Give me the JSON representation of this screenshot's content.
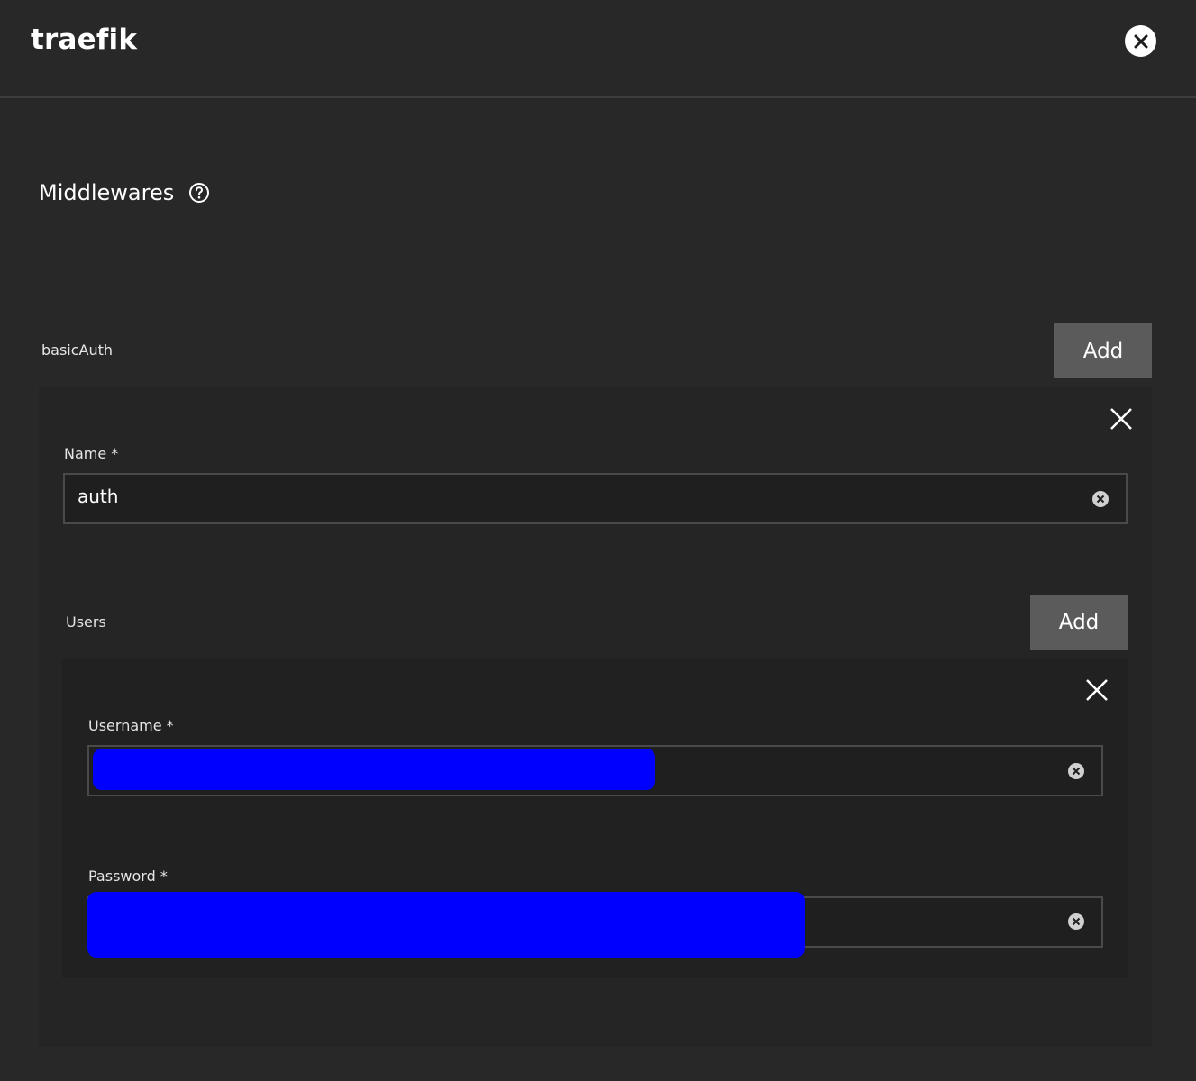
{
  "app": {
    "title": "traefik"
  },
  "section": {
    "title": "Middlewares"
  },
  "basic_auth": {
    "label": "basicAuth",
    "add_label": "Add",
    "name_field": {
      "label": "Name *",
      "value": "auth"
    },
    "users": {
      "label": "Users",
      "add_label": "Add",
      "username_field": {
        "label": "Username *",
        "value": ""
      },
      "password_field": {
        "label": "Password *",
        "value": ""
      }
    }
  },
  "icons": {
    "close": "close-circle-icon",
    "help": "help-circle-icon",
    "remove": "x-icon",
    "clear": "clear-circle-icon"
  },
  "colors": {
    "background": "#282828",
    "button": "#5b5b5b",
    "redaction": "#0000ff"
  }
}
